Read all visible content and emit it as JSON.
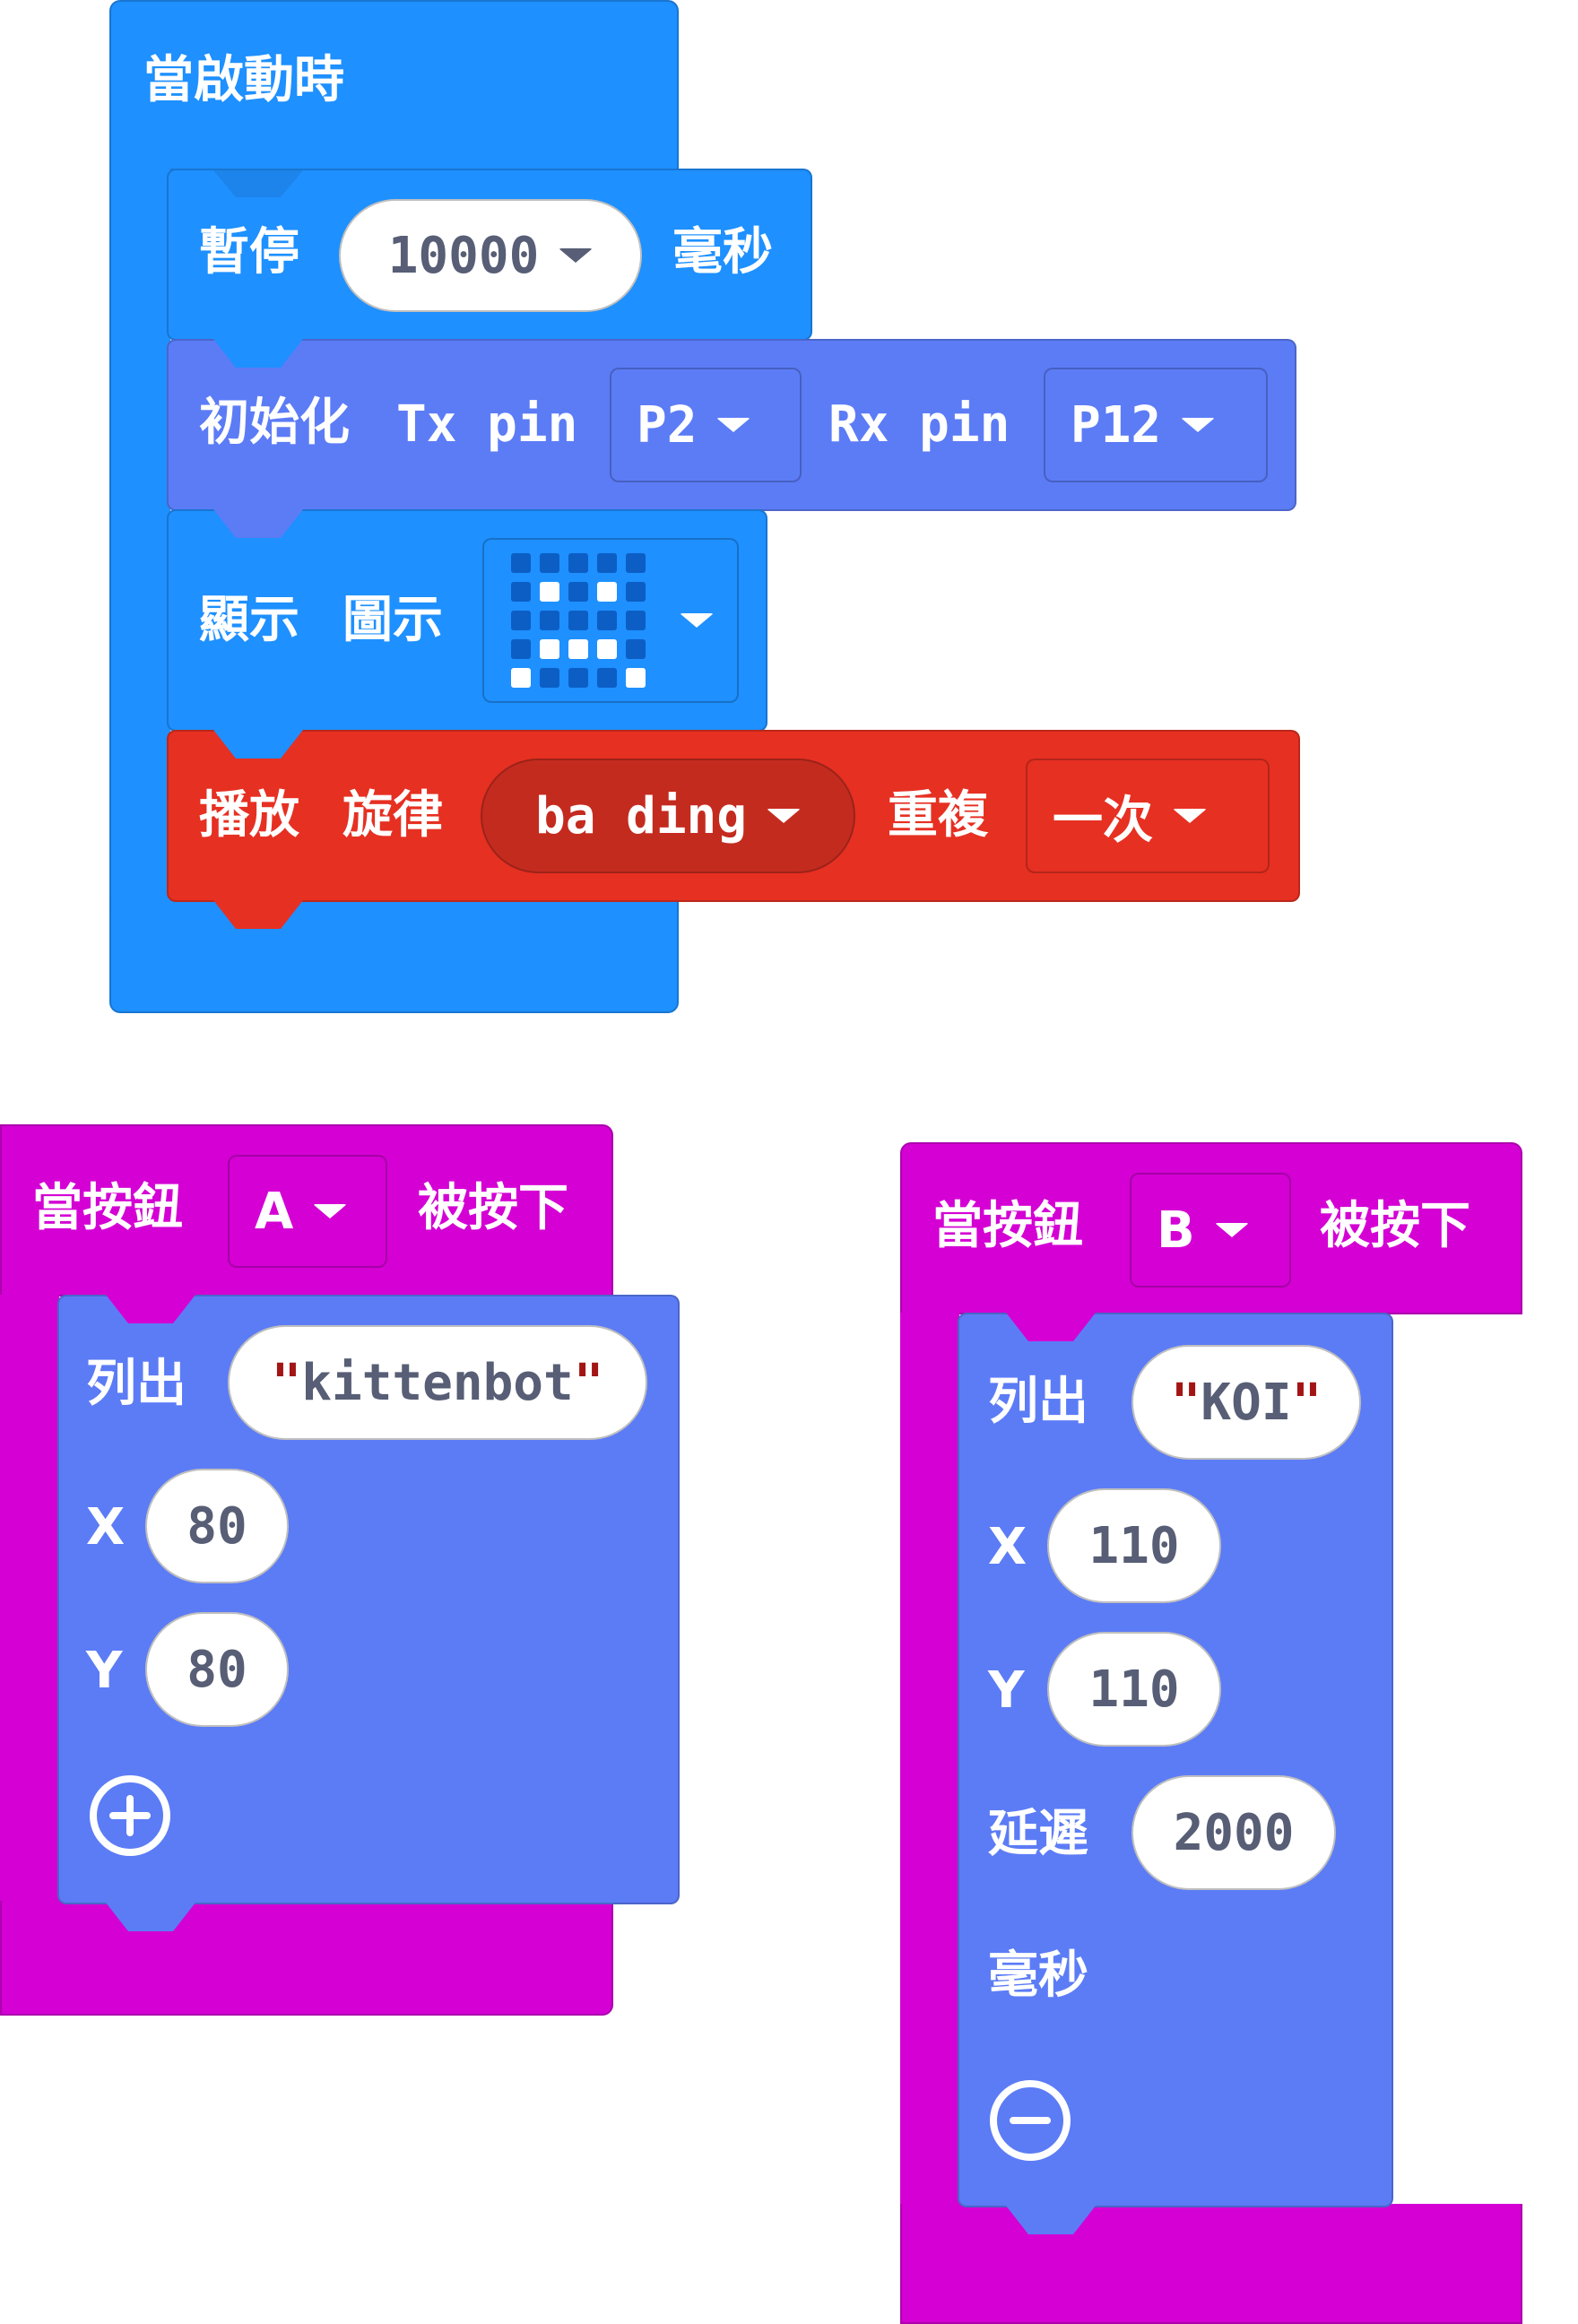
{
  "on_start": {
    "hat_label": "當啟動時",
    "pause": {
      "label": "暫停",
      "value": "10000",
      "unit": "毫秒"
    },
    "serial_init": {
      "label": "初始化",
      "tx_label": "Tx pin",
      "tx_value": "P2",
      "rx_label": "Rx pin",
      "rx_value": "P12"
    },
    "show_icon": {
      "label_1": "顯示",
      "label_2": "圖示",
      "icon_pattern": [
        [
          0,
          0,
          0,
          0,
          0
        ],
        [
          0,
          1,
          0,
          1,
          0
        ],
        [
          0,
          0,
          0,
          0,
          0
        ],
        [
          0,
          1,
          1,
          1,
          0
        ],
        [
          1,
          0,
          0,
          0,
          1
        ]
      ]
    },
    "play_melody": {
      "label_1": "播放",
      "label_2": "旋律",
      "melody": "ba ding",
      "repeat_label": "重複",
      "repeat_value": "一次"
    }
  },
  "button_a": {
    "prefix": "當按鈕",
    "button": "A",
    "suffix": "被按下",
    "list": {
      "label": "列出",
      "text": "kittenbot",
      "x_label": "X",
      "x_value": "80",
      "y_label": "Y",
      "y_value": "80"
    },
    "action_icon": "plus-circle-icon"
  },
  "button_b": {
    "prefix": "當按鈕",
    "button": "B",
    "suffix": "被按下",
    "list": {
      "label": "列出",
      "text": "KOI",
      "x_label": "X",
      "x_value": "110",
      "y_label": "Y",
      "y_value": "110",
      "delay_label": "延遲",
      "delay_value": "2000",
      "delay_unit": "毫秒"
    },
    "action_icon": "minus-circle-icon"
  },
  "quote_mark": "\"",
  "colors": {
    "basic": "#1e90ff",
    "serial": "#5c7cf6",
    "music": "#e63022",
    "music_dark": "#c42b1f",
    "input": "#d400d4",
    "led_on": "#ffffff",
    "led_off": "#0c5ec5"
  }
}
